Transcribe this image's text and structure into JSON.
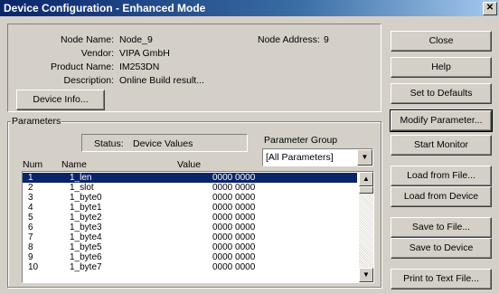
{
  "window": {
    "title": "Device Configuration - Enhanced Mode",
    "close_glyph": "✕"
  },
  "device": {
    "node_name_label": "Node Name:",
    "node_name": "Node_9",
    "vendor_label": "Vendor:",
    "vendor": "VIPA GmbH",
    "product_label": "Product Name:",
    "product": "IM253DN",
    "description_label": "Description:",
    "description": "Online Build result...",
    "node_address_label": "Node Address:",
    "node_address": "9",
    "info_button": "Device Info..."
  },
  "parameters": {
    "group_label": "Parameters",
    "status_label": "Status:",
    "status_value": "Device Values",
    "param_group_label": "Parameter Group",
    "param_group_value": "[All Parameters]",
    "columns": {
      "num": "Num",
      "name": "Name",
      "value": "Value"
    },
    "rows": [
      {
        "num": "1",
        "name": "1_len",
        "value": "0000 0000"
      },
      {
        "num": "2",
        "name": "1_slot",
        "value": "0000 0000"
      },
      {
        "num": "3",
        "name": "1_byte0",
        "value": "0000 0000"
      },
      {
        "num": "4",
        "name": "1_byte1",
        "value": "0000 0000"
      },
      {
        "num": "5",
        "name": "1_byte2",
        "value": "0000 0000"
      },
      {
        "num": "6",
        "name": "1_byte3",
        "value": "0000 0000"
      },
      {
        "num": "7",
        "name": "1_byte4",
        "value": "0000 0000"
      },
      {
        "num": "8",
        "name": "1_byte5",
        "value": "0000 0000"
      },
      {
        "num": "9",
        "name": "1_byte6",
        "value": "0000 0000"
      },
      {
        "num": "10",
        "name": "1_byte7",
        "value": "0000 0000"
      }
    ]
  },
  "buttons": {
    "close": "Close",
    "help": "Help",
    "set_defaults": "Set to Defaults",
    "modify": "Modify Parameter...",
    "start_monitor": "Start Monitor",
    "load_file": "Load from File...",
    "load_device": "Load from Device",
    "save_file": "Save to File...",
    "save_device": "Save to Device",
    "print": "Print to Text File..."
  }
}
